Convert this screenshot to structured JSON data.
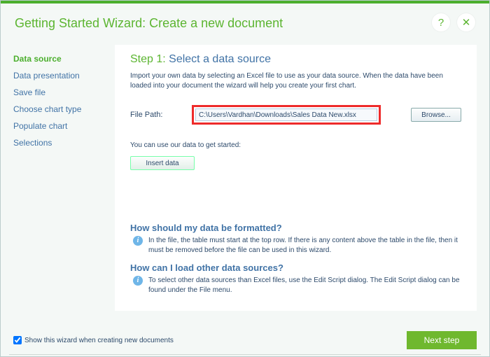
{
  "header": {
    "title": "Getting Started Wizard: Create a new document",
    "help": "?",
    "close": "✕"
  },
  "sidebar": {
    "items": [
      {
        "label": "Data source",
        "active": true
      },
      {
        "label": "Data presentation",
        "active": false
      },
      {
        "label": "Save file",
        "active": false
      },
      {
        "label": "Choose chart type",
        "active": false
      },
      {
        "label": "Populate chart",
        "active": false
      },
      {
        "label": "Selections",
        "active": false
      }
    ]
  },
  "main": {
    "step_num": "Step 1:",
    "step_label": "Select a data source",
    "desc": "Import your own data by selecting an Excel file to use as your data source. When the data have been loaded into your document the wizard will help you create your first chart.",
    "file_label": "File Path:",
    "file_value": "C:\\Users\\Vardhan\\Downloads\\Sales Data New.xlsx",
    "browse": "Browse...",
    "use_our": "You can use our data to get started:",
    "insert": "Insert data",
    "faq1_q": "How should my data be formatted?",
    "faq1_a": "In the file, the table must start at the top row. If there is any content above the table in the file, then it must be removed before the file can be used in this wizard.",
    "faq2_q": "How can I load other data sources?",
    "faq2_a": "To select other data sources than Excel files, use the Edit Script dialog. The Edit Script dialog can be found under the File menu."
  },
  "footer": {
    "checkbox_label": "Show this wizard when creating new documents",
    "next": "Next step"
  }
}
